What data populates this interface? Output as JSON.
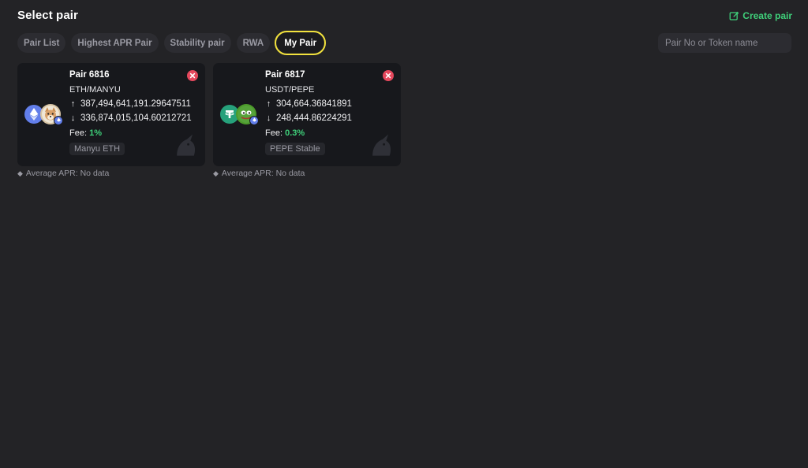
{
  "header": {
    "title": "Select pair",
    "create_label": "Create pair"
  },
  "tabs": [
    {
      "label": "Pair List",
      "active": false
    },
    {
      "label": "Highest APR Pair",
      "active": false
    },
    {
      "label": "Stability pair",
      "active": false
    },
    {
      "label": "RWA",
      "active": false
    },
    {
      "label": "My Pair",
      "active": true
    }
  ],
  "search": {
    "placeholder": "Pair No or Token name",
    "value": ""
  },
  "pairs": [
    {
      "number": "Pair 6816",
      "name": "ETH/MANYU",
      "reserve_up": "387,494,641,191.29647511",
      "reserve_down": "336,874,015,104.60212721",
      "fee_label": "Fee:",
      "fee_value": "1%",
      "tag": "Manyu ETH",
      "token1_icon": "eth-token-icon",
      "token2_icon": "manyu-token-icon",
      "network_icon": "eth-network-icon",
      "apr_label": "Average APR: No data"
    },
    {
      "number": "Pair 6817",
      "name": "USDT/PEPE",
      "reserve_up": "304,664.36841891",
      "reserve_down": "248,444.86224291",
      "fee_label": "Fee:",
      "fee_value": "0.3%",
      "tag": "PEPE Stable",
      "token1_icon": "usdt-token-icon",
      "token2_icon": "pepe-token-icon",
      "network_icon": "eth-network-icon",
      "apr_label": "Average APR: No data"
    }
  ],
  "icons": {
    "arrow_up": "↑",
    "arrow_down": "↓",
    "diamond": "◆"
  },
  "colors": {
    "background": "#232326",
    "card": "#17181c",
    "accent_green": "#3fd07a",
    "active_outline": "#f2e23d",
    "close_red": "#e5485d",
    "eth": "#627eea",
    "usdt": "#26a17b",
    "pepe": "#4c9a2a"
  }
}
